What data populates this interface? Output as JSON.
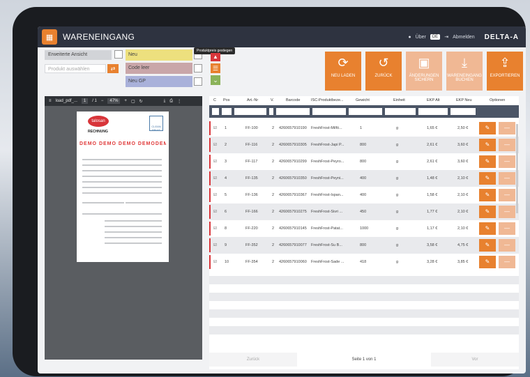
{
  "app": {
    "title": "WARENEINGANG",
    "info_label": "Über",
    "lang": "DE",
    "logout_label": "Abmelden",
    "brand": "DELTA-A"
  },
  "controls": {
    "ansicht_label": "Erweiterte Ansicht",
    "produkt_placeholder": "Produkt auswählen",
    "tags": {
      "neu": "Neu",
      "code": "Code leer",
      "gp": "Neu GP"
    },
    "tooltip": "Produktpreis gestiegen"
  },
  "actions": [
    {
      "label": "NEU LADEN",
      "icon": "refresh-icon",
      "state": "active"
    },
    {
      "label": "ZURÜCK",
      "icon": "undo-icon",
      "state": "active"
    },
    {
      "label": "ÄNDERUNGEN SICHERN",
      "icon": "save-icon",
      "state": "dim"
    },
    {
      "label": "WARENEINGANG BUCHEN",
      "icon": "download-icon",
      "state": "dim"
    },
    {
      "label": "EXPORTIEREN",
      "icon": "export-icon",
      "state": "active"
    }
  ],
  "pdf": {
    "file": "load_pdf_...",
    "page": "1",
    "pages": "/ 1",
    "zoom": "47%",
    "rechnung": "RECHNUNG",
    "demo": "DEMO DEMO DEMO DEMODEMO",
    "logo1": "talosan",
    "logo2": "CLEAN FRUIT"
  },
  "table": {
    "headers": [
      "C",
      "Pos",
      "Art.-Nr",
      "V.",
      "Barcode",
      "ISC-Produktbeze...",
      "Gewicht",
      "Einheit",
      "EKP Alt",
      "EKP Neu",
      "Optionen"
    ],
    "rows": [
      {
        "pos": "1",
        "art": "FF-100",
        "v": "2",
        "barcode": "4260657910190",
        "name": "FreshFrost-Milfö...",
        "gewicht": "1",
        "einheit": "g",
        "alt": "1,65 €",
        "neu": "2,50 €"
      },
      {
        "pos": "2",
        "art": "FF-116",
        "v": "2",
        "barcode": "4260657910305",
        "name": "FreshFrost-Japi P...",
        "gewicht": "800",
        "einheit": "g",
        "alt": "2,61 €",
        "neu": "3,60 €"
      },
      {
        "pos": "3",
        "art": "FF-117",
        "v": "2",
        "barcode": "4260657910299",
        "name": "FreshFrost-Peyro...",
        "gewicht": "800",
        "einheit": "g",
        "alt": "2,61 €",
        "neu": "3,60 €"
      },
      {
        "pos": "4",
        "art": "FF-135",
        "v": "2",
        "barcode": "4260657910350",
        "name": "FreshFrost-Peyni...",
        "gewicht": "400",
        "einheit": "g",
        "alt": "1,48 €",
        "neu": "2,10 €"
      },
      {
        "pos": "5",
        "art": "FF-136",
        "v": "2",
        "barcode": "4260657910367",
        "name": "FreshFrost-Ispan...",
        "gewicht": "400",
        "einheit": "g",
        "alt": "1,58 €",
        "neu": "2,10 €"
      },
      {
        "pos": "6",
        "art": "FF-166",
        "v": "2",
        "barcode": "4260657910275",
        "name": "FreshFrost-Sivri ...",
        "gewicht": "450",
        "einheit": "g",
        "alt": "1,77 €",
        "neu": "2,10 €"
      },
      {
        "pos": "8",
        "art": "FF-220",
        "v": "2",
        "barcode": "4260657910145",
        "name": "FreshFrost-Patat...",
        "gewicht": "1000",
        "einheit": "g",
        "alt": "1,17 €",
        "neu": "2,10 €"
      },
      {
        "pos": "9",
        "art": "FF-352",
        "v": "2",
        "barcode": "4260657910077",
        "name": "FreshFrost-Su B...",
        "gewicht": "800",
        "einheit": "g",
        "alt": "3,58 €",
        "neu": "4,75 €"
      },
      {
        "pos": "10",
        "art": "FF-354",
        "v": "2",
        "barcode": "4260657910060",
        "name": "FreshFrost-Sade ...",
        "gewicht": "418",
        "einheit": "g",
        "alt": "3,28 €",
        "neu": "3,85 €"
      }
    ]
  },
  "pager": {
    "prev": "Zurück",
    "status": "Seite 1 von 1",
    "next": "Vor"
  },
  "colors": {
    "accent": "#e8812f",
    "topbar": "#2e3340",
    "danger": "#d8353a"
  }
}
